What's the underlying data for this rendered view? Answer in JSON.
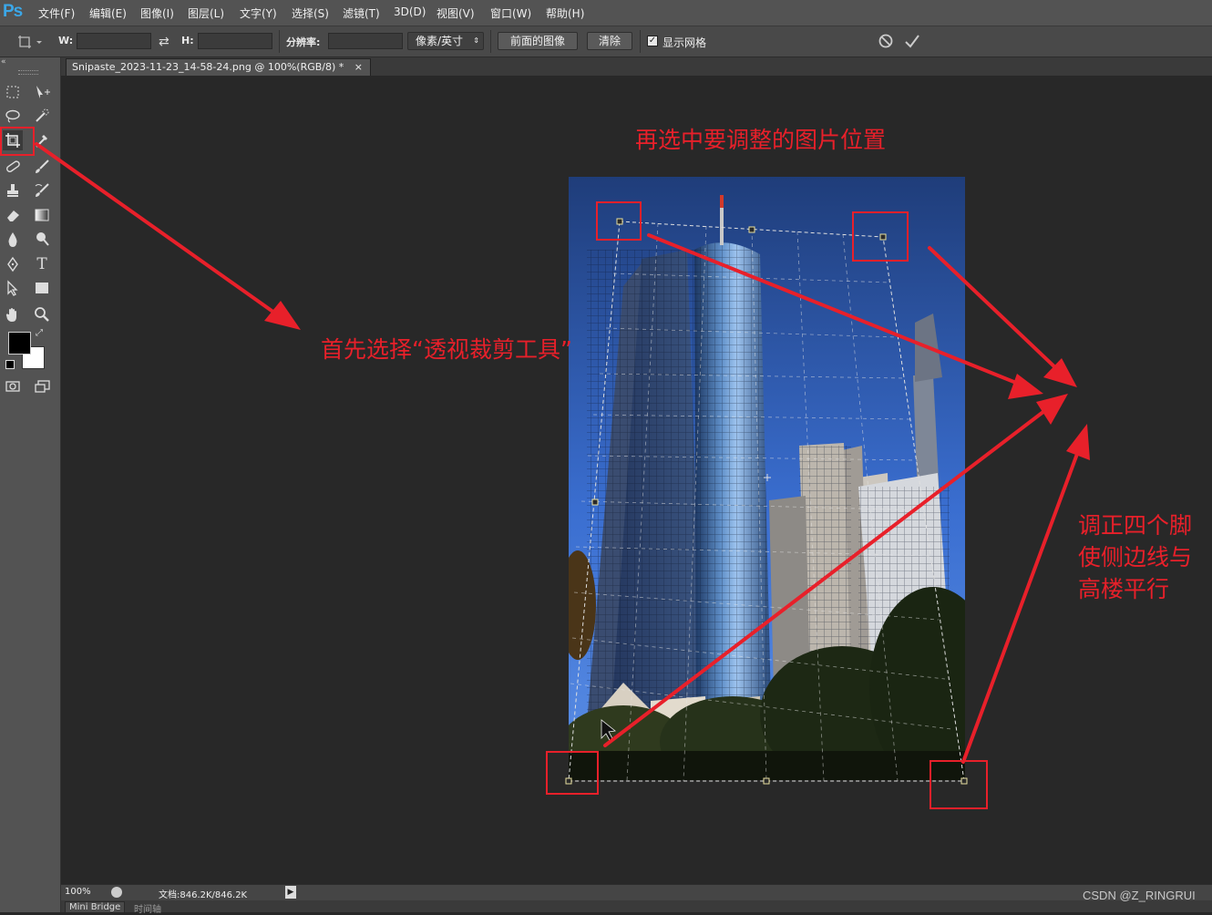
{
  "app": {
    "logo": "Ps"
  },
  "menu": [
    {
      "id": "file",
      "label": "文件(F)"
    },
    {
      "id": "edit",
      "label": "编辑(E)"
    },
    {
      "id": "image",
      "label": "图像(I)"
    },
    {
      "id": "layer",
      "label": "图层(L)"
    },
    {
      "id": "type",
      "label": "文字(Y)"
    },
    {
      "id": "select",
      "label": "选择(S)"
    },
    {
      "id": "filter",
      "label": "滤镜(T)"
    },
    {
      "id": "3d",
      "label": "3D(D)"
    },
    {
      "id": "view",
      "label": "视图(V)"
    },
    {
      "id": "window",
      "label": "窗口(W)"
    },
    {
      "id": "help",
      "label": "帮助(H)"
    }
  ],
  "options": {
    "w_label": "W:",
    "w_value": "",
    "h_label": "H:",
    "h_value": "",
    "resolution_label": "分辨率:",
    "resolution_value": "",
    "unit_select": "像素/英寸",
    "front_image_button": "前面的图像",
    "clear_button": "清除",
    "show_grid_label": "显示网格",
    "show_grid_checked": true
  },
  "document": {
    "tab_title": "Snipaste_2023-11-23_14-58-24.png @ 100%(RGB/8) *",
    "close_glyph": "×"
  },
  "status": {
    "zoom": "100%",
    "doc_info": "文档:846.2K/846.2K"
  },
  "bottom_tabs": [
    "Mini Bridge",
    "时间轴"
  ],
  "annotations": {
    "step_select_area": "再选中要调整的图片位置",
    "step_select_tool": "首先选择“透视裁剪工具”",
    "step_adjust_line1": "调正四个脚",
    "step_adjust_line2": "使侧边线与",
    "step_adjust_line3": "高楼平行"
  },
  "watermark": "CSDN @Z_RINGRUI",
  "colors": {
    "annotation_red": "#e8202a",
    "ps_blue": "#3ba7e8",
    "canvas_bg": "#282828",
    "panel_gray": "#535353"
  },
  "tools": [
    "rect-marquee-icon",
    "move-icon",
    "lasso-icon",
    "quick-select-icon",
    "perspective-crop-icon",
    "eyedropper-icon",
    "healing-brush-icon",
    "brush-icon",
    "clone-stamp-icon",
    "history-brush-icon",
    "eraser-icon",
    "gradient-icon",
    "blur-icon",
    "dodge-icon",
    "pen-icon",
    "type-icon",
    "path-select-icon",
    "rectangle-shape-icon",
    "hand-icon",
    "zoom-icon"
  ]
}
